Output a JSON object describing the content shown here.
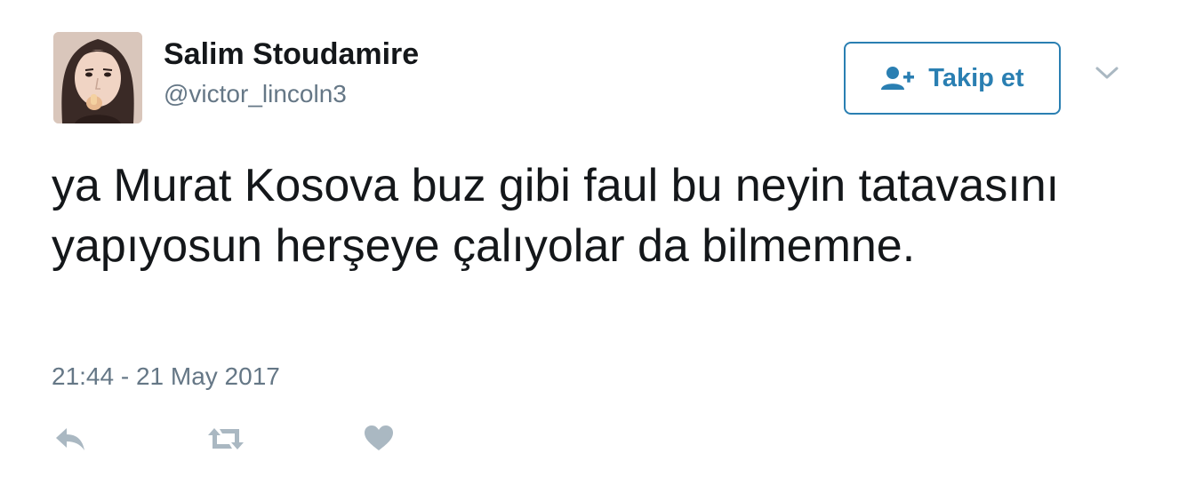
{
  "tweet": {
    "author": {
      "display_name": "Salim Stoudamire",
      "handle": "@victor_lincoln3"
    },
    "follow_button": {
      "label": "Takip et",
      "icon": "add-user-icon",
      "color": "#2a7fb2"
    },
    "menu_icon": "chevron-down-icon",
    "text": "ya Murat Kosova buz gibi faul bu neyin tatavasını yapıyosun herşeye çalıyolar da bilmemne.",
    "timestamp": "21:44 - 21 May 2017",
    "actions": [
      {
        "icon": "reply-icon"
      },
      {
        "icon": "retweet-icon"
      },
      {
        "icon": "like-icon"
      }
    ],
    "colors": {
      "text": "#14171a",
      "muted": "#657786",
      "action_icons": "#aab8c2"
    }
  }
}
